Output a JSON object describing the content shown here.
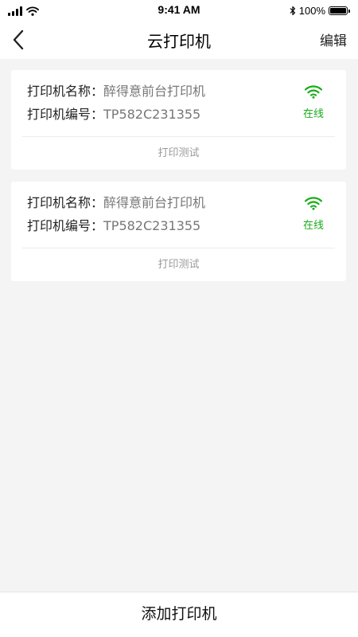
{
  "status_bar": {
    "time": "9:41 AM",
    "battery": "100%"
  },
  "nav": {
    "title": "云打印机",
    "edit_label": "编辑"
  },
  "printers": [
    {
      "name_label": "打印机名称：",
      "name": "醉得意前台打印机",
      "code_label": "打印机编号：",
      "code": "TP582C231355",
      "status": "在线",
      "test_label": "打印测试"
    },
    {
      "name_label": "打印机名称：",
      "name": "醉得意前台打印机",
      "code_label": "打印机编号：",
      "code": "TP582C231355",
      "status": "在线",
      "test_label": "打印测试"
    }
  ],
  "bottom": {
    "add_label": "添加打印机"
  },
  "icons": {
    "signal": "signal-bars-icon",
    "wifi": "wifi-icon",
    "bluetooth": "bluetooth-icon",
    "battery": "battery-icon",
    "back": "chevron-left-icon",
    "online": "wifi-icon"
  },
  "colors": {
    "online": "#1aac19",
    "background": "#f4f4f4",
    "card": "#ffffff"
  }
}
